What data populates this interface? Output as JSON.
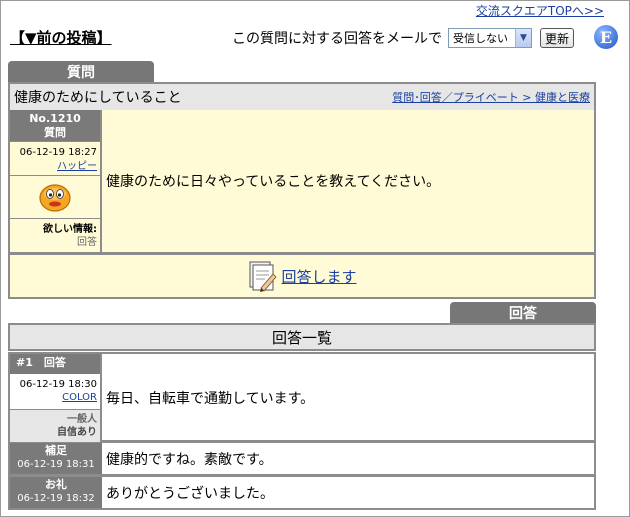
{
  "header": {
    "top_link": "交流スクエアTOPへ>>",
    "prev_post": "【▼前の投稿】",
    "mail_label": "この質問に対する回答をメールで",
    "mail_select_value": "受信しない",
    "update_button": "更新",
    "e_icon_letter": "E"
  },
  "tabs": {
    "question": "質問",
    "answer": "回答"
  },
  "question": {
    "title": "健康のためにしていること",
    "breadcrumb": "質問･回答／プライベート > 健康と医療",
    "number": "No.1210",
    "kind": "質問",
    "date": "06-12-19 18:27",
    "author": "ハッピー",
    "wanted_label": "欲しい情報:",
    "wanted_value": "回答",
    "body": "健康のために日々やっていることを教えてください。",
    "answer_link": "回答します"
  },
  "answers": {
    "list_title": "回答一覧",
    "items": [
      {
        "header": "#1　回答",
        "date": "06-12-19 18:30",
        "author": "COLOR",
        "rank1": "一般人",
        "rank2": "自信あり",
        "body": "毎日、自転車で通勤しています。"
      }
    ],
    "followups": [
      {
        "label": "補足",
        "date": "06-12-19 18:31",
        "body": "健康的ですね。素敵です。"
      },
      {
        "label": "お礼",
        "date": "06-12-19 18:32",
        "body": "ありがとうございました。"
      }
    ]
  },
  "colors": {
    "tab_gray": "#777777",
    "cream": "#fffbd6",
    "link_blue": "#1a3fa0"
  }
}
